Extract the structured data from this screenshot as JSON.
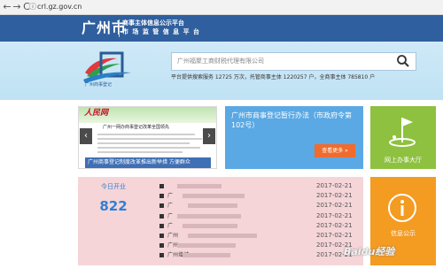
{
  "browser": {
    "back": "←",
    "forward": "→",
    "reload": "C",
    "url": "crl.gz.gov.cn"
  },
  "header": {
    "city": "广州市",
    "subtitle_line1": "商事主体信息公示平台",
    "subtitle_line2": "市 场 监 管 信 息 平 台"
  },
  "logo": {
    "caption": "广州商事登记"
  },
  "search": {
    "value": "广州福聚工商财税代理有限公司",
    "stats": "平台提供搜索服务 12725 万次，托管商事主体 1220257 户，全商事主体 785810 户"
  },
  "news": {
    "brand": "人民网",
    "doc_title": "广州一网办商事登记改革全国领先",
    "caption": "广州商事登记制度改革推出新举措 方便群众"
  },
  "notice": {
    "title": "广州市商事登记暂行办法（市政府令第102号）",
    "more_label": "查看更多 »"
  },
  "online": {
    "label": "网上办事大厅"
  },
  "today": {
    "label": "今日开业",
    "count": "822",
    "rows": [
      {
        "name": "",
        "date": "2017-02-21"
      },
      {
        "name": "广",
        "date": "2017-02-21"
      },
      {
        "name": "广",
        "date": "2017-02-21"
      },
      {
        "name": "广",
        "date": "2017-02-21"
      },
      {
        "name": "广",
        "date": "2017-02-21"
      },
      {
        "name": "广州",
        "date": "2017-02-21"
      },
      {
        "name": "广州",
        "date": "2017-02-21"
      },
      {
        "name": "广州增城",
        "date": "2017-02-21"
      }
    ]
  },
  "public_info": {
    "label": "信息公示"
  },
  "watermark": "Baidu经验",
  "colors": {
    "header_blue": "#2f5f9e",
    "notice_blue": "#5aa8e4",
    "online_green": "#8dc13f",
    "public_orange": "#f49b22",
    "today_pink": "#f5d5d8",
    "more_orange": "#ef6c2e"
  },
  "icons": {
    "search": "search-icon",
    "online": "golf-flag-icon",
    "public": "info-icon"
  }
}
